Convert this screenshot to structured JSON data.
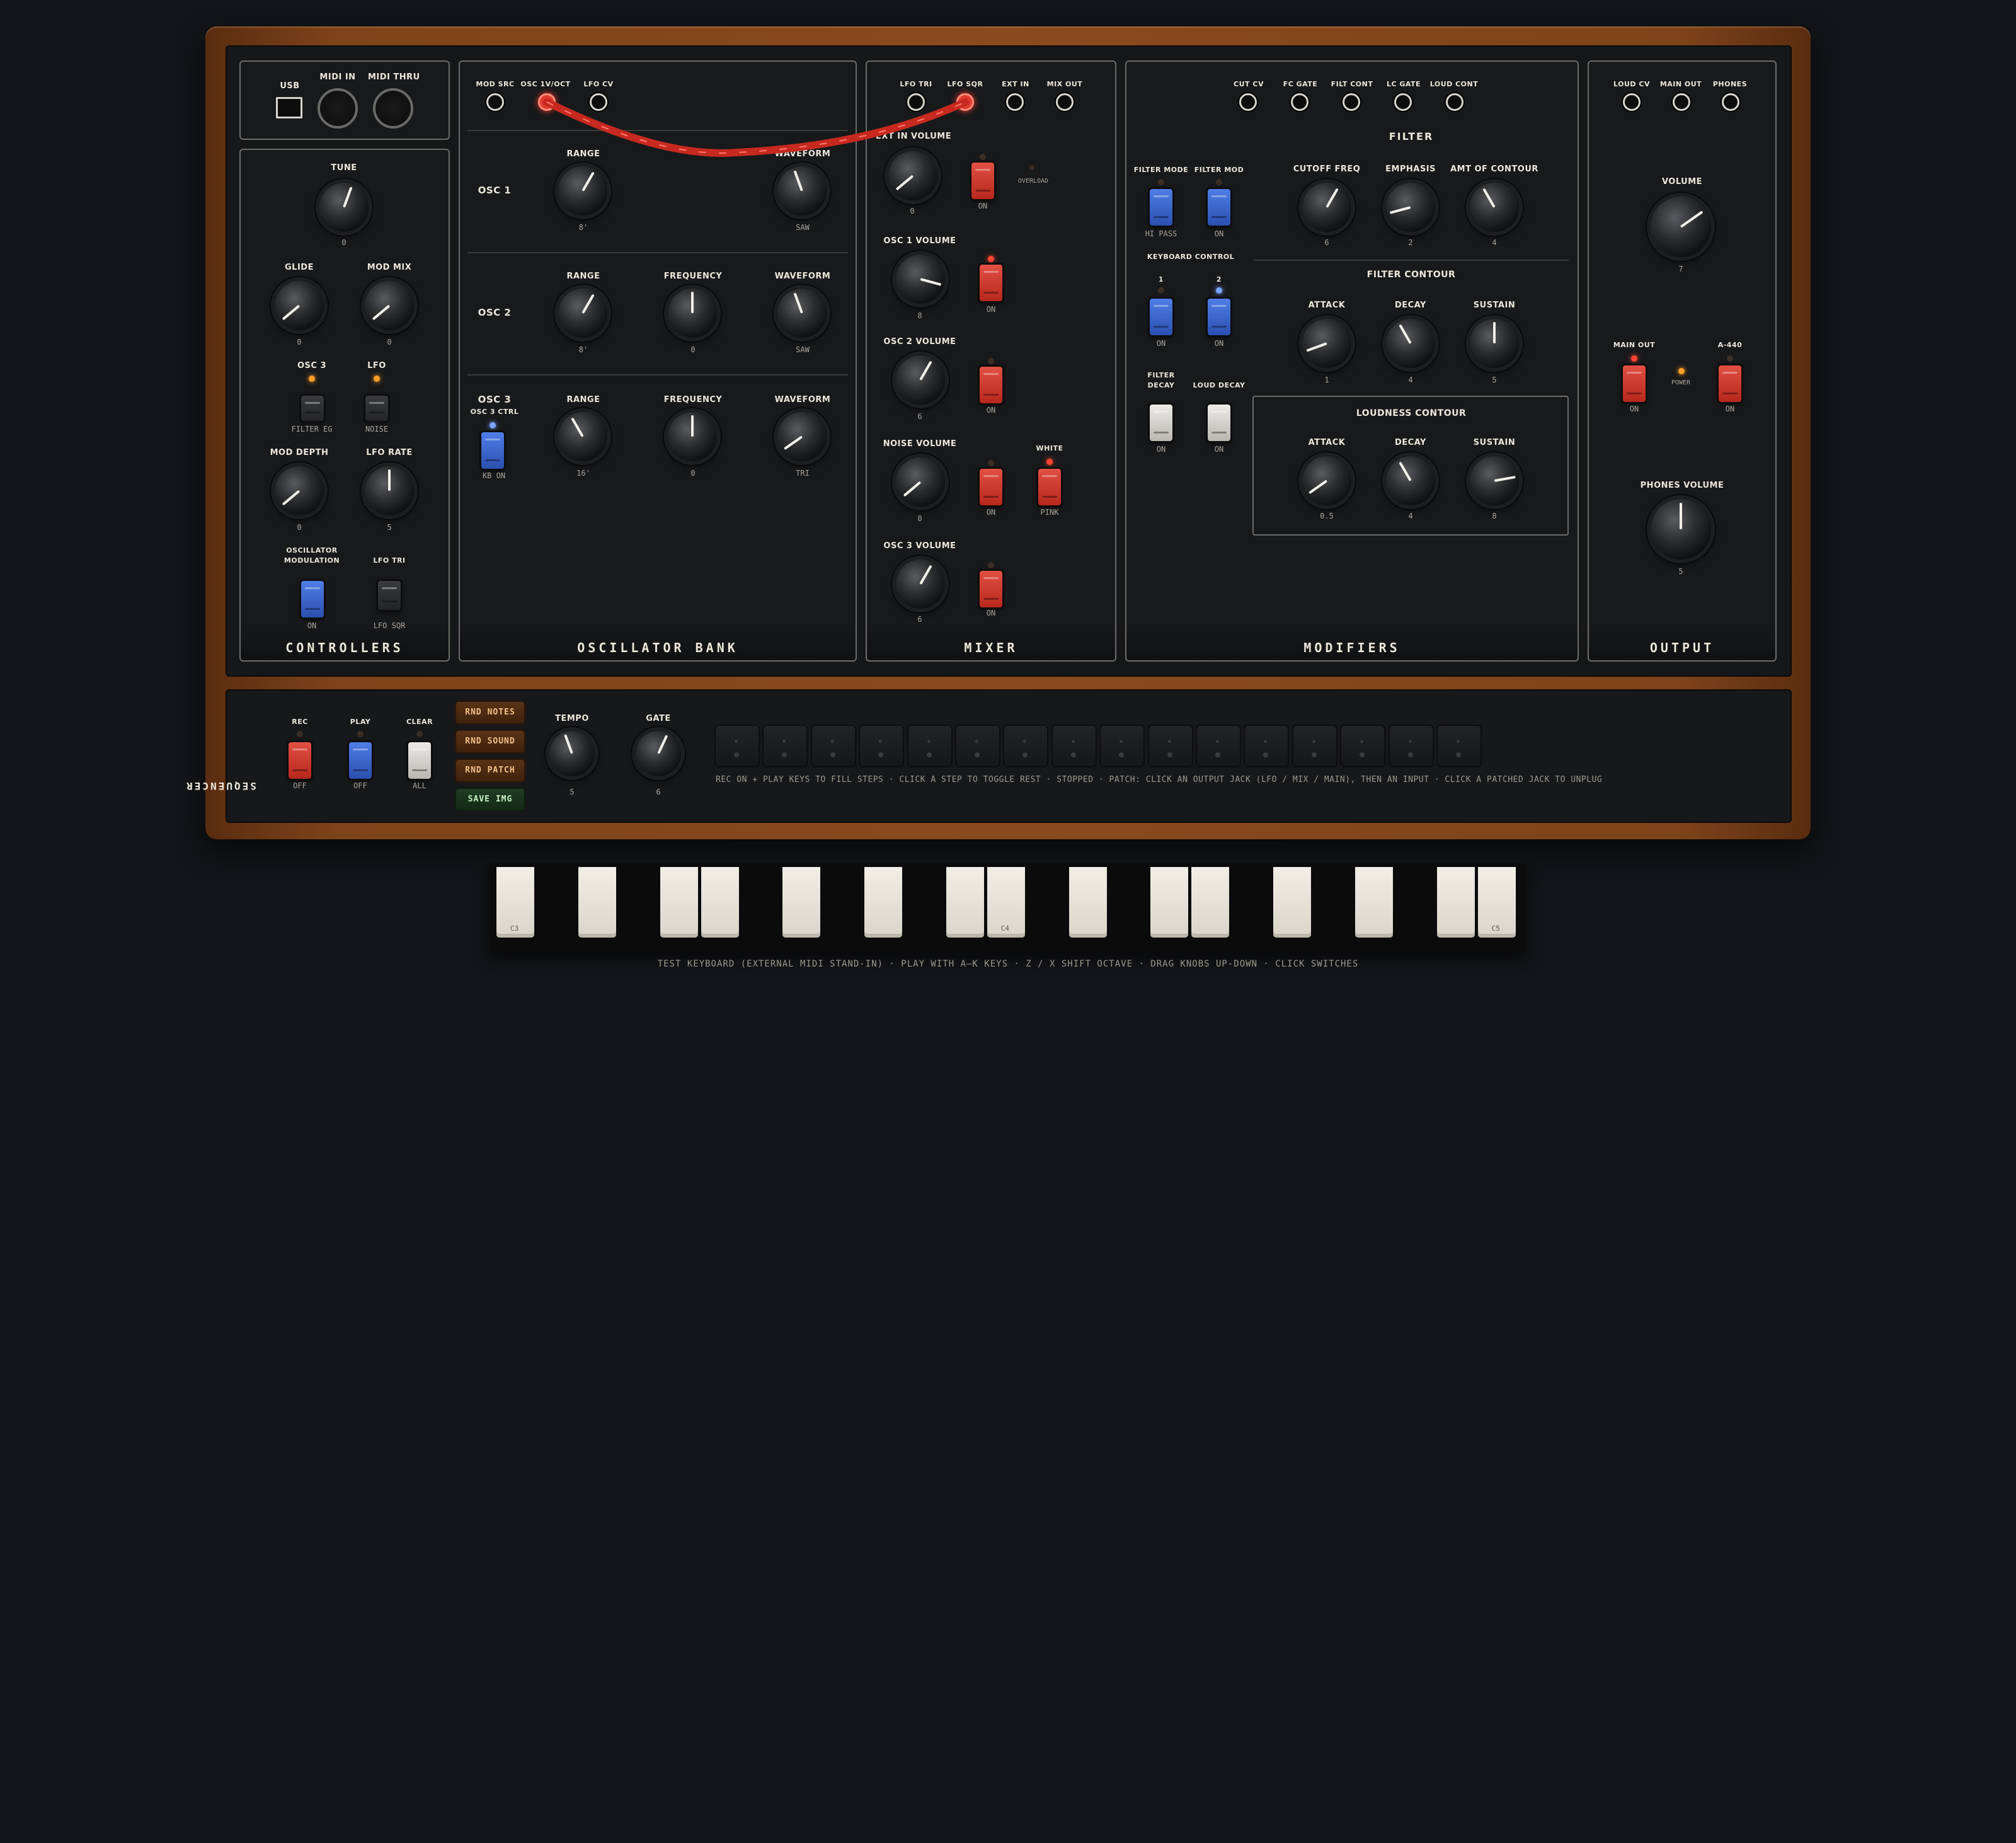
{
  "colors": {
    "wood": "#8a4a1d",
    "panel": "#161719",
    "patch_cable": "#e03a2e",
    "led_orange": "#ff9f2a",
    "switch_red": "#c7342a",
    "switch_blue": "#3a63c8"
  },
  "controllers": {
    "title": "CONTROLLERS",
    "usb": "USB",
    "midi_in": "MIDI IN",
    "midi_thru": "MIDI THRU",
    "tune": {
      "label": "TUNE",
      "value": "0"
    },
    "glide": {
      "label": "GLIDE",
      "value": "0"
    },
    "mod_mix": {
      "label": "MOD MIX",
      "value": "0"
    },
    "osc3_led": "OSC 3",
    "lfo_led": "LFO",
    "filter_eg": "FILTER EG",
    "noise": "NOISE",
    "mod_depth": {
      "label": "MOD DEPTH",
      "value": "0"
    },
    "lfo_rate": {
      "label": "LFO RATE",
      "value": "5"
    },
    "osc_mod": {
      "label1": "OSCILLATOR",
      "label2": "MODULATION",
      "state": "ON"
    },
    "lfo_tri": {
      "label": "LFO TRI",
      "state": "LFO SQR"
    }
  },
  "osc_bank": {
    "title": "OSCILLATOR BANK",
    "jacks": [
      "MOD SRC",
      "OSC 1V/OCT",
      "LFO CV"
    ],
    "osc1": {
      "name": "OSC 1",
      "range_label": "RANGE",
      "range": "8'",
      "waveform_label": "WAVEFORM",
      "waveform": "SAW"
    },
    "osc2": {
      "name": "OSC 2",
      "range_label": "RANGE",
      "range": "8'",
      "freq_label": "FREQUENCY",
      "freq": "0",
      "waveform_label": "WAVEFORM",
      "waveform": "SAW"
    },
    "osc3": {
      "name": "OSC 3",
      "ctrl": "OSC 3 CTRL",
      "ctrl_state": "KB ON",
      "range_label": "RANGE",
      "range": "16'",
      "freq_label": "FREQUENCY",
      "freq": "0",
      "waveform_label": "WAVEFORM",
      "waveform": "TRI"
    }
  },
  "mixer": {
    "title": "MIXER",
    "jacks": [
      "LFO TRI",
      "LFO SQR",
      "EXT IN",
      "MIX OUT"
    ],
    "ext_in": {
      "label": "EXT IN VOLUME",
      "value": "0",
      "state": "ON",
      "overload": "OVERLOAD"
    },
    "osc1": {
      "label": "OSC 1 VOLUME",
      "value": "8",
      "state": "ON"
    },
    "osc2": {
      "label": "OSC 2 VOLUME",
      "value": "6",
      "state": "ON"
    },
    "noise": {
      "label": "NOISE VOLUME",
      "value": "0",
      "state": "ON",
      "white": "WHITE",
      "pink": "PINK"
    },
    "osc3": {
      "label": "OSC 3 VOLUME",
      "value": "6",
      "state": "ON"
    }
  },
  "modifiers": {
    "title": "MODIFIERS",
    "jacks": [
      "CUT CV",
      "FC GATE",
      "FILT CONT",
      "LC GATE",
      "LOUD CONT"
    ],
    "filter_title": "FILTER",
    "filter_mode": {
      "label": "FILTER MODE",
      "state": "HI PASS"
    },
    "filter_mod": {
      "label": "FILTER MOD",
      "state": "ON"
    },
    "keyboard_control": "KEYBOARD CONTROL",
    "kc1": {
      "label": "1",
      "state": "ON"
    },
    "kc2": {
      "label": "2",
      "state": "ON"
    },
    "filter_decay": {
      "label1": "FILTER",
      "label2": "DECAY",
      "state": "ON"
    },
    "loud_decay": {
      "label": "LOUD DECAY",
      "state": "ON"
    },
    "cutoff": {
      "label": "CUTOFF FREQ",
      "value": "6"
    },
    "emphasis": {
      "label": "EMPHASIS",
      "value": "2"
    },
    "amt": {
      "label": "AMT OF CONTOUR",
      "value": "4"
    },
    "filter_contour": "FILTER CONTOUR",
    "fc_attack": {
      "label": "ATTACK",
      "value": "1"
    },
    "fc_decay": {
      "label": "DECAY",
      "value": "4"
    },
    "fc_sustain": {
      "label": "SUSTAIN",
      "value": "5"
    },
    "loudness_contour": "LOUDNESS CONTOUR",
    "lc_attack": {
      "label": "ATTACK",
      "value": "0.5"
    },
    "lc_decay": {
      "label": "DECAY",
      "value": "4"
    },
    "lc_sustain": {
      "label": "SUSTAIN",
      "value": "8"
    }
  },
  "output": {
    "title": "OUTPUT",
    "jacks": [
      "LOUD CV",
      "MAIN OUT",
      "PHONES"
    ],
    "volume": {
      "label": "VOLUME",
      "value": "7"
    },
    "main_out": {
      "label": "MAIN OUT",
      "state": "ON"
    },
    "power": "POWER",
    "a440": {
      "label": "A-440",
      "state": "ON"
    },
    "phones": {
      "label": "PHONES VOLUME",
      "value": "5"
    }
  },
  "sequencer": {
    "label": "SEQUENCER",
    "rec": {
      "label": "REC",
      "state": "OFF"
    },
    "play": {
      "label": "PLAY",
      "state": "OFF"
    },
    "clear": {
      "label": "CLEAR",
      "state": "ALL"
    },
    "buttons": [
      "RND NOTES",
      "RND SOUND",
      "RND PATCH",
      "SAVE IMG"
    ],
    "tempo": {
      "label": "TEMPO",
      "value": "5"
    },
    "gate": {
      "label": "GATE",
      "value": "6"
    },
    "hint": "REC ON + PLAY KEYS TO FILL STEPS · CLICK A STEP TO TOGGLE REST · STOPPED · PATCH: CLICK AN OUTPUT JACK (LFO / MIX / MAIN), THEN AN INPUT · CLICK A PATCHED JACK TO UNPLUG"
  },
  "keyboard": {
    "labels": [
      "C3",
      "C4",
      "C5"
    ],
    "hint": "TEST KEYBOARD (EXTERNAL MIDI STAND-IN) · PLAY WITH A–K KEYS · Z / X SHIFT OCTAVE · DRAG KNOBS UP-DOWN · CLICK SWITCHES"
  }
}
